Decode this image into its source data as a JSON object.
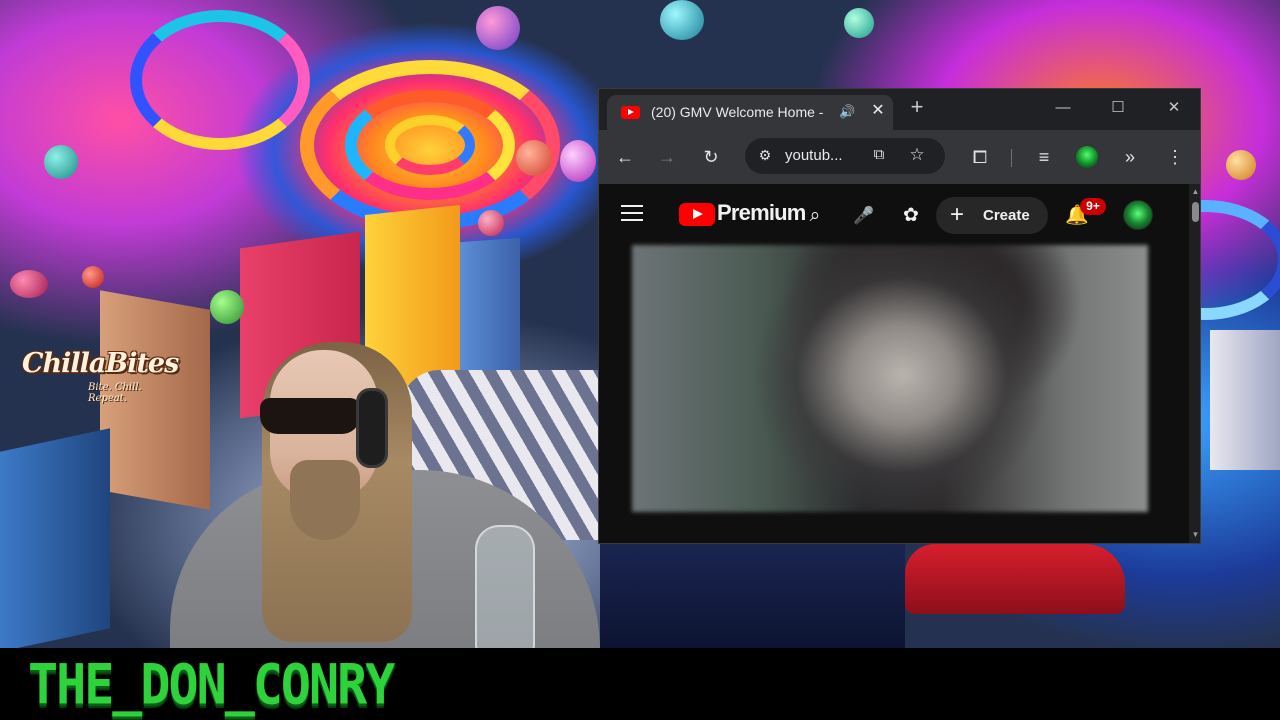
{
  "stream": {
    "overlay_logo": {
      "title": "ChillaBites",
      "tagline": "Bite. Chill. Repeat."
    },
    "streamer_name": "THE_DON_CONRY"
  },
  "browser": {
    "tab": {
      "title": "(20) GMV Welcome Home -",
      "audio_icon": "speaker-icon",
      "close_icon": "close-icon"
    },
    "new_tab_icon": "plus-icon",
    "window_controls": [
      "minimize-icon",
      "maximize-icon",
      "close-icon"
    ],
    "toolbar": {
      "back_icon": "back-arrow-icon",
      "forward_icon": "forward-arrow-icon",
      "reload_icon": "reload-icon",
      "address": "youtub...",
      "site_settings_icon": "tune-icon",
      "install_icon": "install-app-icon",
      "bookmark_icon": "star-icon",
      "extensions_icon": "puzzle-icon",
      "reading_list_icon": "playlist-icon",
      "more_icon": "kebab-menu-icon"
    }
  },
  "youtube": {
    "brand": "Premium",
    "create_label": "Create",
    "notification_badge": "9+",
    "icons": {
      "menu": "hamburger-icon",
      "search": "search-icon",
      "mic": "mic-icon",
      "extension": "ghost-extension-icon",
      "bell": "bell-icon"
    },
    "colors": {
      "brand_red": "#ff0000",
      "badge_red": "#cc0000",
      "bg": "#0f0f0f"
    }
  }
}
